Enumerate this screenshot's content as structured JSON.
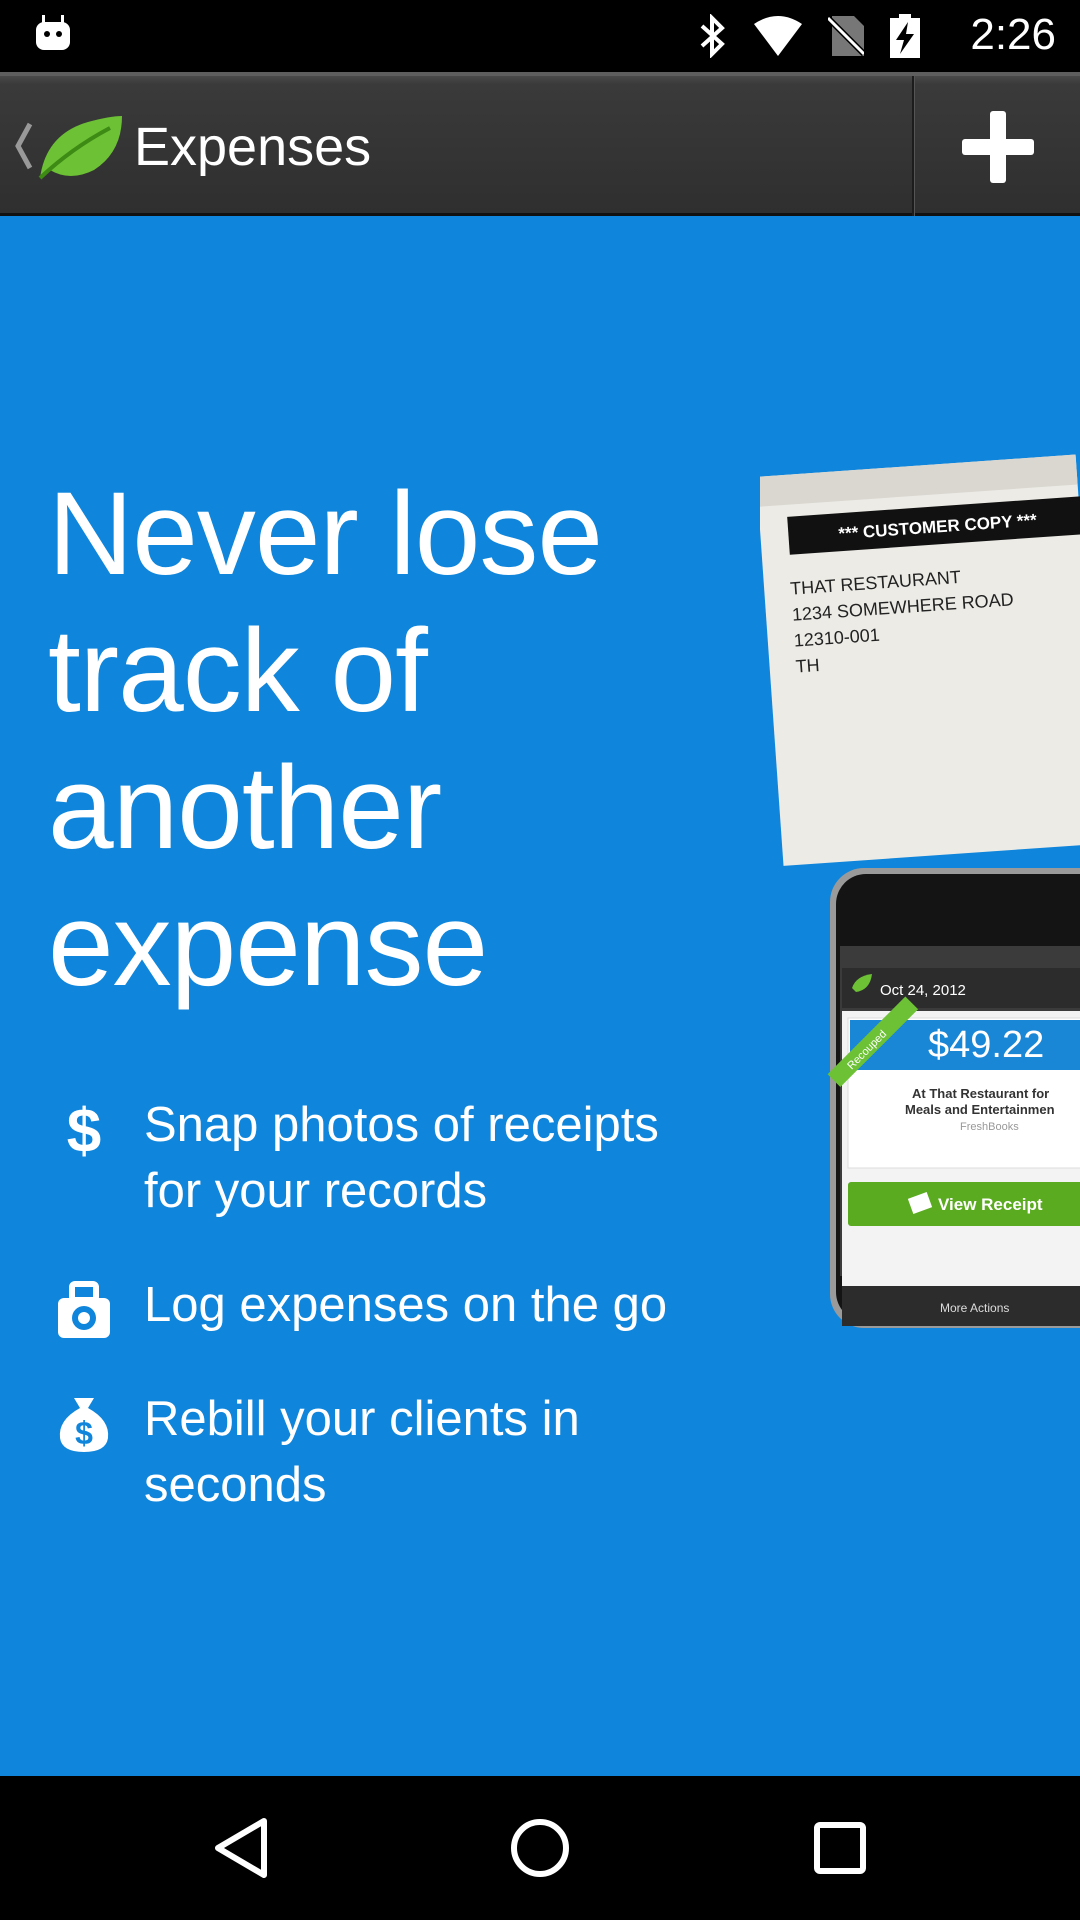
{
  "status_bar": {
    "time": "2:26",
    "icons": [
      "android-debug-icon",
      "bluetooth-icon",
      "wifi-icon",
      "no-sim-icon",
      "battery-charging-icon"
    ]
  },
  "action_bar": {
    "title": "Expenses",
    "add_icon": "plus-icon",
    "bg_color": "#333333"
  },
  "main": {
    "bg_color": "#0f85db",
    "headline": [
      "Never lose",
      "track of",
      "another",
      "expense"
    ],
    "features": [
      {
        "icon": "dollar-icon",
        "text": "Snap photos of receipts for your records"
      },
      {
        "icon": "camera-icon",
        "text": "Log expenses on the go"
      },
      {
        "icon": "money-bag-icon",
        "text": "Rebill your clients in seconds"
      }
    ]
  },
  "illustration": {
    "receipt": {
      "header": "*** CUSTOMER COPY ***",
      "lines": [
        "THAT RESTAURANT",
        "1234 SOMEWHERE ROAD",
        "12310-001",
        "TH"
      ]
    },
    "phone": {
      "date": "Oct 24, 2012",
      "ribbon": "Recouped",
      "amount": "$49.22",
      "desc_line1": "At That Restaurant for",
      "desc_line2": "Meals and Entertainmen",
      "company": "FreshBooks",
      "button": "View Receipt",
      "more_actions": "More Actions"
    }
  },
  "nav_bar": {
    "buttons": [
      "back-icon",
      "home-icon",
      "recents-icon"
    ]
  }
}
